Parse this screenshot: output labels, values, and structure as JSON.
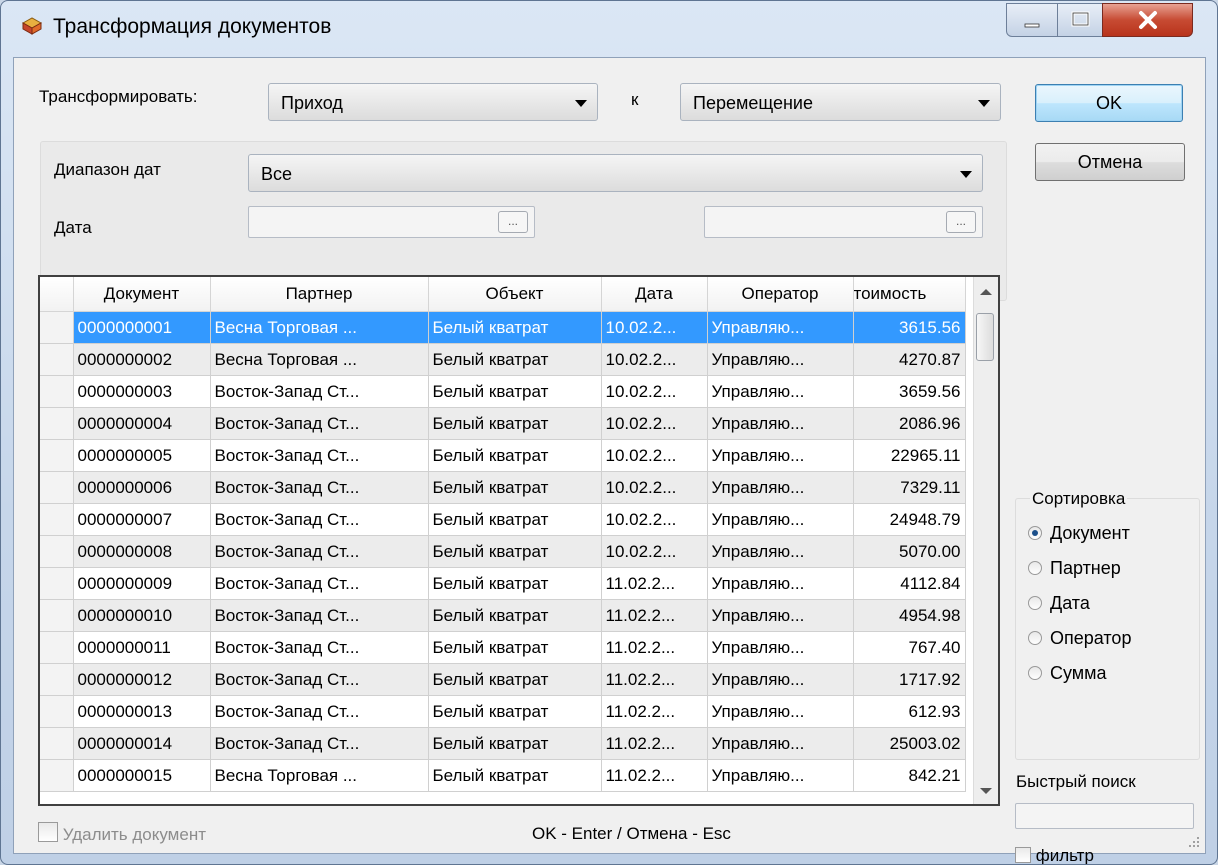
{
  "window": {
    "title": "Трансформация документов"
  },
  "transform": {
    "label": "Трансформировать:",
    "from_value": "Приход",
    "to_label": "к",
    "to_value": "Перемещение"
  },
  "date": {
    "range_label": "Диапазон дат",
    "range_value": "Все",
    "date_label": "Дата",
    "browse_label": "..."
  },
  "buttons": {
    "ok": "OK",
    "cancel": "Отмена"
  },
  "grid": {
    "columns": [
      "Документ",
      "Партнер",
      "Объект",
      "Дата",
      "Оператор",
      "Стоимость"
    ],
    "column_header_visible": [
      "Документ",
      "Партнер",
      "Объект",
      "Дата",
      "Оператор",
      "тоимость"
    ],
    "rows": [
      [
        "0000000001",
        "Весна Торговая ...",
        "Белый кватрат",
        "10.02.2...",
        "Управляю...",
        "3615.56"
      ],
      [
        "0000000002",
        "Весна Торговая ...",
        "Белый кватрат",
        "10.02.2...",
        "Управляю...",
        "4270.87"
      ],
      [
        "0000000003",
        "Восток-Запад Ст...",
        "Белый кватрат",
        "10.02.2...",
        "Управляю...",
        "3659.56"
      ],
      [
        "0000000004",
        "Восток-Запад Ст...",
        "Белый кватрат",
        "10.02.2...",
        "Управляю...",
        "2086.96"
      ],
      [
        "0000000005",
        "Восток-Запад Ст...",
        "Белый кватрат",
        "10.02.2...",
        "Управляю...",
        "22965.11"
      ],
      [
        "0000000006",
        "Восток-Запад Ст...",
        "Белый кватрат",
        "10.02.2...",
        "Управляю...",
        "7329.11"
      ],
      [
        "0000000007",
        "Восток-Запад Ст...",
        "Белый кватрат",
        "10.02.2...",
        "Управляю...",
        "24948.79"
      ],
      [
        "0000000008",
        "Восток-Запад Ст...",
        "Белый кватрат",
        "10.02.2...",
        "Управляю...",
        "5070.00"
      ],
      [
        "0000000009",
        "Восток-Запад Ст...",
        "Белый кватрат",
        "11.02.2...",
        "Управляю...",
        "4112.84"
      ],
      [
        "0000000010",
        "Восток-Запад Ст...",
        "Белый кватрат",
        "11.02.2...",
        "Управляю...",
        "4954.98"
      ],
      [
        "0000000011",
        "Восток-Запад Ст...",
        "Белый кватрат",
        "11.02.2...",
        "Управляю...",
        "767.40"
      ],
      [
        "0000000012",
        "Восток-Запад Ст...",
        "Белый кватрат",
        "11.02.2...",
        "Управляю...",
        "1717.92"
      ],
      [
        "0000000013",
        "Восток-Запад Ст...",
        "Белый кватрат",
        "11.02.2...",
        "Управляю...",
        "612.93"
      ],
      [
        "0000000014",
        "Восток-Запад Ст...",
        "Белый кватрат",
        "11.02.2...",
        "Управляю...",
        "25003.02"
      ],
      [
        "0000000015",
        "Весна Торговая ...",
        "Белый кватрат",
        "11.02.2...",
        "Управляю...",
        "842.21"
      ]
    ],
    "selected_row": 0
  },
  "sort": {
    "title": "Сортировка",
    "options": [
      "Документ",
      "Партнер",
      "Дата",
      "Оператор",
      "Сумма"
    ],
    "selected": 0
  },
  "quick_search": {
    "label": "Быстрый поиск",
    "value": "",
    "filter_label": "фильтр",
    "filter_checked": false
  },
  "footer": {
    "delete_label": "Удалить документ",
    "delete_checked": false,
    "hint": "OK - Enter / Отмена - Esc"
  }
}
